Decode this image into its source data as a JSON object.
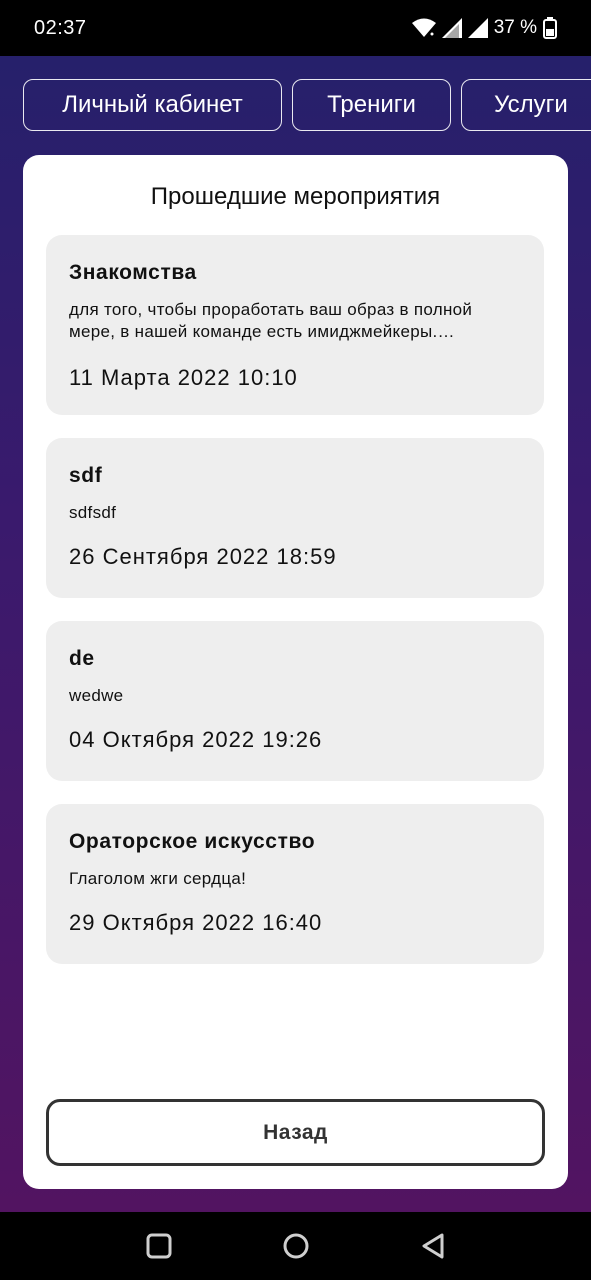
{
  "status_bar": {
    "time": "02:37",
    "battery_text": "37 %",
    "icons": [
      "wifi-icon",
      "signal-icon",
      "signal-icon",
      "battery-icon"
    ]
  },
  "tabs": [
    {
      "label": "Личный кабинет"
    },
    {
      "label": "Трениги"
    },
    {
      "label": "Услуги"
    }
  ],
  "section": {
    "title": "Прошедшие мероприятия"
  },
  "events": [
    {
      "title": "Знакомства",
      "description": "для того, чтобы проработать ваш образ в полной мере, в нашей команде есть имиджмейкеры.…",
      "date": "11 Марта 2022 10:10"
    },
    {
      "title": "sdf",
      "description": "sdfsdf",
      "date": "26 Сентября 2022 18:59"
    },
    {
      "title": "de",
      "description": "wedwe",
      "date": "04 Октября 2022 19:26"
    },
    {
      "title": "Ораторское искусство",
      "description": "Глаголом жги сердца!",
      "date": "29 Октября 2022 16:40"
    }
  ],
  "back_button": {
    "label": "Назад"
  },
  "nav_bar": {
    "icons": [
      "recent-apps-icon",
      "home-icon",
      "back-icon"
    ]
  },
  "colors": {
    "gradient_top": "#26206b",
    "gradient_bottom": "#521461",
    "card_bg": "#ffffff",
    "event_bg": "#eeeeee"
  }
}
